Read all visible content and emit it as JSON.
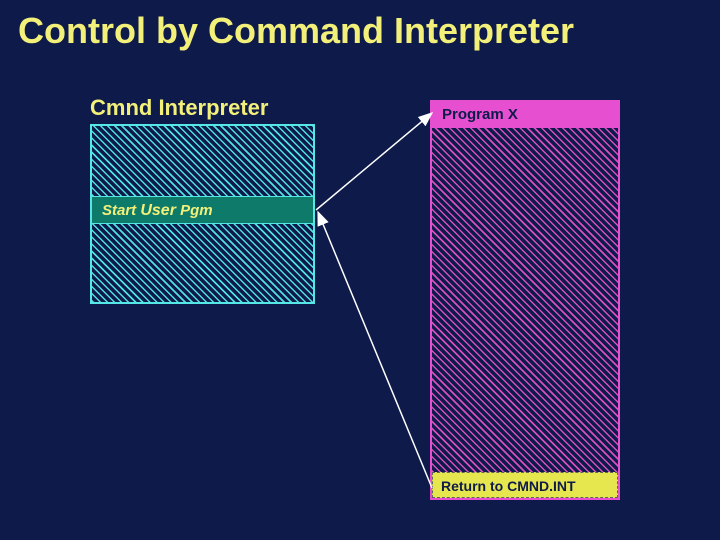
{
  "title": "Control by Command Interpreter",
  "cmnd": {
    "label": "Cmnd Interpreter",
    "mid_prefix": "Start ",
    "mid_user": "User",
    "mid_suffix": " Pgm"
  },
  "program": {
    "header": "Program X",
    "footer": "Return to CMND.INT"
  }
}
